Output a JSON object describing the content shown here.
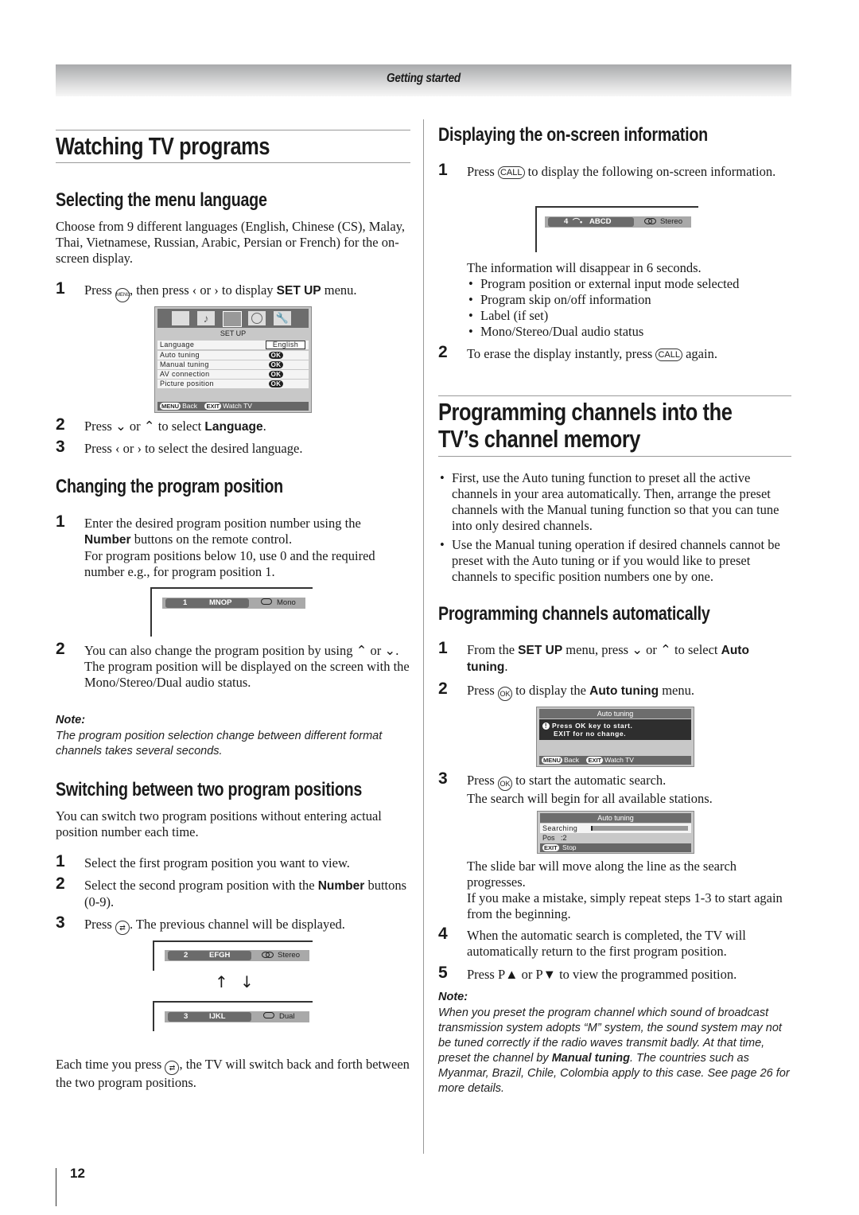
{
  "header": {
    "section": "Getting started"
  },
  "left": {
    "title": "Watching TV programs",
    "menu_language": {
      "heading": "Selecting the menu language",
      "intro": "Choose from 9 different languages (English, Chinese (CS), Malay, Thai, Vietnamese, Russian, Arabic, Persian or French) for the on-screen display.",
      "steps": [
        {
          "num": "1",
          "pre": "Press ",
          "key": "MENU",
          "mid": ", then press ‹ or › to display ",
          "bold": "SET UP",
          "post": " menu."
        },
        {
          "num": "2",
          "pre": "Press ⌄ or ⌃ to select ",
          "bold": "Language",
          "post": "."
        },
        {
          "num": "3",
          "text": "Press ‹ or › to select the desired language."
        }
      ],
      "setup_menu": {
        "title": "SET UP",
        "icons": [
          "picture-icon",
          "sound-icon",
          "setup-icon",
          "timer-icon",
          "wrench-icon"
        ],
        "rows": [
          {
            "label": "Language",
            "value": "English"
          },
          {
            "label": "Auto tuning",
            "value": "OK"
          },
          {
            "label": "Manual tuning",
            "value": "OK"
          },
          {
            "label": "AV connection",
            "value": "OK"
          },
          {
            "label": "Picture position",
            "value": "OK"
          }
        ],
        "footer": {
          "menu_key": "MENU",
          "back": "Back",
          "exit_key": "EXIT",
          "watch": "Watch TV"
        }
      }
    },
    "program_position": {
      "heading": "Changing the program position",
      "step1_a": "Enter the desired program position number using the ",
      "step1_bold": "Number",
      "step1_b": " buttons on the remote control.",
      "step1_c": "For program positions below 10, use 0 and the required number e.g., for program position 1.",
      "osd": {
        "pos": "1",
        "label": "MNOP",
        "audio": "Mono"
      },
      "step2_a": "You can also change the program position by using ⌃ or ⌄.",
      "step2_b": "The program position will be displayed on the screen with the Mono/Stereo/Dual audio status.",
      "note_title": "Note:",
      "note_body": "The program position selection change between different format channels takes several seconds."
    },
    "switching": {
      "heading": "Switching between two program positions",
      "intro": "You can switch two program positions without entering actual position number each time.",
      "step1": "Select the first program position you want to view.",
      "step2_a": "Select the second program position with the ",
      "step2_bold": "Number",
      "step2_b": " buttons (0-9).",
      "step3_a": "Press ",
      "step3_b": ". The previous channel will be displayed.",
      "osd_a": {
        "pos": "2",
        "label": "EFGH",
        "audio": "Stereo"
      },
      "osd_b": {
        "pos": "3",
        "label": "IJKL",
        "audio": "Dual"
      },
      "outro_a": "Each time you press ",
      "outro_b": ", the TV will switch back and forth between the two program positions."
    },
    "page_number": "12"
  },
  "right": {
    "onscreen": {
      "heading": "Displaying the on-screen information",
      "step1_a": "Press ",
      "step1_key": "CALL",
      "step1_b": " to display the following on-screen information.",
      "osd": {
        "pos": "4",
        "label": "ABCD",
        "audio": "Stereo"
      },
      "disappear": "The information will disappear in 6 seconds.",
      "bullets": [
        "Program position or external input mode selected",
        "Program skip on/off information",
        "Label (if set)",
        "Mono/Stereo/Dual audio status"
      ],
      "step2_a": "To erase the display instantly, press ",
      "step2_key": "CALL",
      "step2_b": " again."
    },
    "programming": {
      "title_line1": "Programming channels into the",
      "title_line2": "TV’s channel memory",
      "bullets": [
        "First, use the Auto tuning function to preset all the active channels in your area automatically. Then, arrange the preset channels with the Manual tuning function so that you can tune into only desired channels.",
        "Use the Manual tuning operation if desired channels cannot be preset with the Auto tuning or if you would like to preset channels to specific position numbers one by one."
      ]
    },
    "auto": {
      "heading": "Programming channels automatically",
      "step1_a": "From the ",
      "step1_bold1": "SET UP",
      "step1_b": " menu, press ⌄ or ⌃ to select ",
      "step1_bold2": "Auto tuning",
      "step1_c": ".",
      "step2_a": "Press ",
      "step2_key": "OK",
      "step2_b": " to display the ",
      "step2_bold": "Auto tuning",
      "step2_c": " menu.",
      "menu1": {
        "title": "Auto tuning",
        "msg1": "Press OK key to start.",
        "msg2": "EXIT for no change.",
        "footer": {
          "menu_key": "MENU",
          "back": "Back",
          "exit_key": "EXIT",
          "watch": "Watch TV"
        }
      },
      "step3_a": "Press ",
      "step3_key": "OK",
      "step3_b": " to start the automatic search.",
      "step3_c": "The search will begin for all available stations.",
      "menu2": {
        "title": "Auto tuning",
        "searching": "Searching",
        "progress": 0.02,
        "pos_label": "Pos",
        "pos_value": ":2",
        "exit_key": "EXIT",
        "stop": "Stop"
      },
      "slide_a": "The slide bar will move along the line as the search progresses.",
      "slide_b": "If you make a mistake, simply repeat steps 1-3 to start again from the beginning.",
      "step4": "When the automatic search is completed, the TV will automatically return to the first program position.",
      "step5": "Press P▲ or P▼ to view the programmed position.",
      "note_title": "Note:",
      "note_a": "When you preset the program channel which sound of broadcast transmission system adopts “M” system, the sound system may not be tuned correctly if the radio waves transmit badly. At that time, preset the channel by ",
      "note_bold": "Manual tuning",
      "note_b": ". The countries such as Myanmar, Brazil, Chile, Colombia apply to this case. See page 26 for more details."
    }
  }
}
